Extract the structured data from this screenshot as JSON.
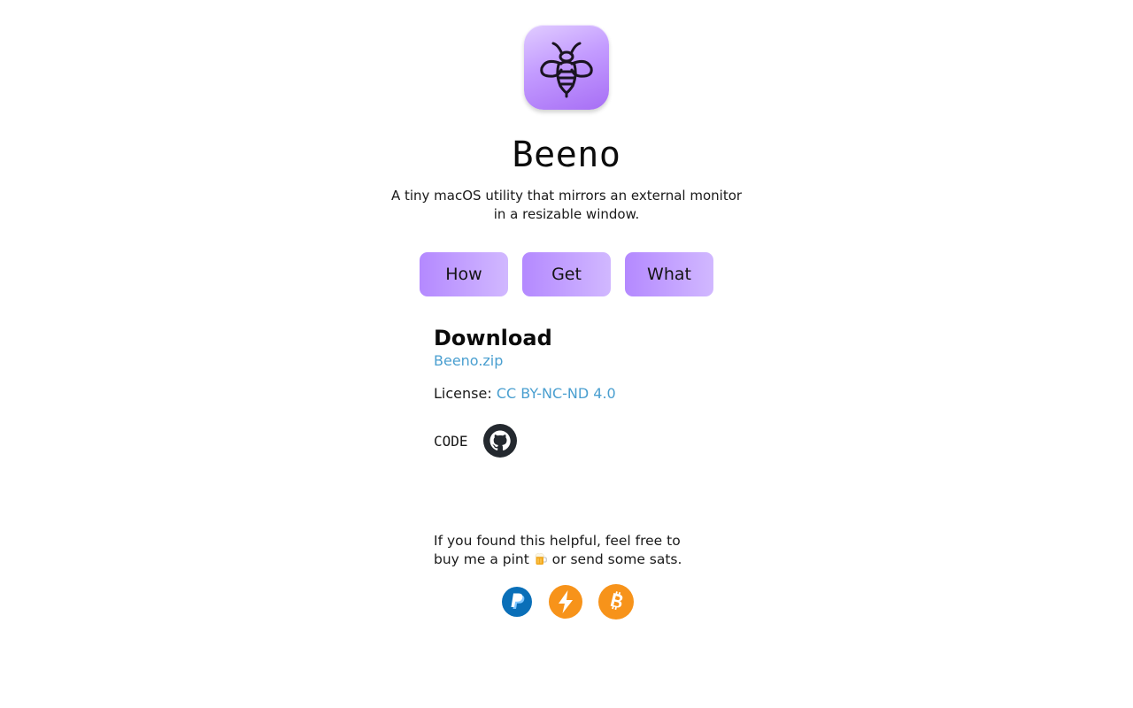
{
  "app": {
    "name": "Beeno",
    "tagline": "A tiny macOS utility that mirrors an external monitor in a resizable window.",
    "icon": "bee-icon",
    "icon_gradient": [
      "#e1cdff",
      "#a76ef5"
    ]
  },
  "nav": {
    "buttons": [
      {
        "label": "How"
      },
      {
        "label": "Get"
      },
      {
        "label": "What"
      }
    ],
    "button_color": "#b489ff"
  },
  "download": {
    "heading": "Download",
    "file_label": "Beeno.zip",
    "license_prefix": "License:",
    "license_label": "CC BY-NC-ND 4.0"
  },
  "code": {
    "label": "CODE",
    "icon": "github-icon"
  },
  "support": {
    "line1": "If you found this helpful, feel free to",
    "line2_before": "buy me a pint",
    "line2_after": "or send some sats.",
    "emoji_icon": "beer-icon",
    "payment_icons": [
      "paypal-icon",
      "lightning-icon",
      "bitcoin-icon"
    ]
  },
  "colors": {
    "link": "#4a9fd0",
    "paypal": "#0a6fb8",
    "bitcoin": "#f7931a"
  }
}
